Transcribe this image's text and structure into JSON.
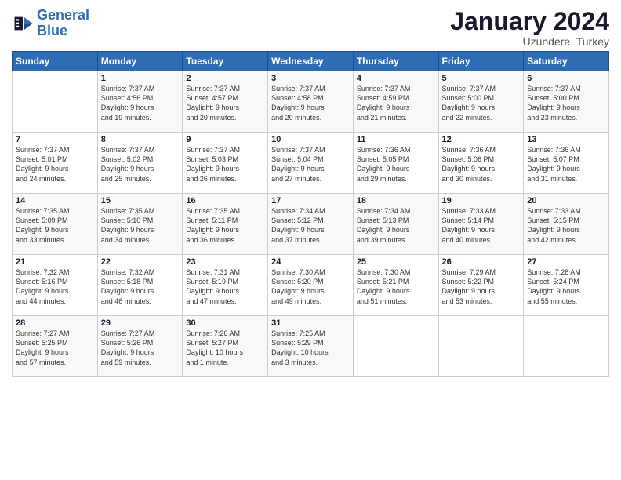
{
  "header": {
    "logo_general": "General",
    "logo_blue": "Blue",
    "month": "January 2024",
    "location": "Uzundere, Turkey"
  },
  "weekdays": [
    "Sunday",
    "Monday",
    "Tuesday",
    "Wednesday",
    "Thursday",
    "Friday",
    "Saturday"
  ],
  "weeks": [
    [
      {
        "day": "",
        "text": ""
      },
      {
        "day": "1",
        "text": "Sunrise: 7:37 AM\nSunset: 4:56 PM\nDaylight: 9 hours\nand 19 minutes."
      },
      {
        "day": "2",
        "text": "Sunrise: 7:37 AM\nSunset: 4:57 PM\nDaylight: 9 hours\nand 20 minutes."
      },
      {
        "day": "3",
        "text": "Sunrise: 7:37 AM\nSunset: 4:58 PM\nDaylight: 9 hours\nand 20 minutes."
      },
      {
        "day": "4",
        "text": "Sunrise: 7:37 AM\nSunset: 4:59 PM\nDaylight: 9 hours\nand 21 minutes."
      },
      {
        "day": "5",
        "text": "Sunrise: 7:37 AM\nSunset: 5:00 PM\nDaylight: 9 hours\nand 22 minutes."
      },
      {
        "day": "6",
        "text": "Sunrise: 7:37 AM\nSunset: 5:00 PM\nDaylight: 9 hours\nand 23 minutes."
      }
    ],
    [
      {
        "day": "7",
        "text": "Sunrise: 7:37 AM\nSunset: 5:01 PM\nDaylight: 9 hours\nand 24 minutes."
      },
      {
        "day": "8",
        "text": "Sunrise: 7:37 AM\nSunset: 5:02 PM\nDaylight: 9 hours\nand 25 minutes."
      },
      {
        "day": "9",
        "text": "Sunrise: 7:37 AM\nSunset: 5:03 PM\nDaylight: 9 hours\nand 26 minutes."
      },
      {
        "day": "10",
        "text": "Sunrise: 7:37 AM\nSunset: 5:04 PM\nDaylight: 9 hours\nand 27 minutes."
      },
      {
        "day": "11",
        "text": "Sunrise: 7:36 AM\nSunset: 5:05 PM\nDaylight: 9 hours\nand 29 minutes."
      },
      {
        "day": "12",
        "text": "Sunrise: 7:36 AM\nSunset: 5:06 PM\nDaylight: 9 hours\nand 30 minutes."
      },
      {
        "day": "13",
        "text": "Sunrise: 7:36 AM\nSunset: 5:07 PM\nDaylight: 9 hours\nand 31 minutes."
      }
    ],
    [
      {
        "day": "14",
        "text": "Sunrise: 7:35 AM\nSunset: 5:09 PM\nDaylight: 9 hours\nand 33 minutes."
      },
      {
        "day": "15",
        "text": "Sunrise: 7:35 AM\nSunset: 5:10 PM\nDaylight: 9 hours\nand 34 minutes."
      },
      {
        "day": "16",
        "text": "Sunrise: 7:35 AM\nSunset: 5:11 PM\nDaylight: 9 hours\nand 36 minutes."
      },
      {
        "day": "17",
        "text": "Sunrise: 7:34 AM\nSunset: 5:12 PM\nDaylight: 9 hours\nand 37 minutes."
      },
      {
        "day": "18",
        "text": "Sunrise: 7:34 AM\nSunset: 5:13 PM\nDaylight: 9 hours\nand 39 minutes."
      },
      {
        "day": "19",
        "text": "Sunrise: 7:33 AM\nSunset: 5:14 PM\nDaylight: 9 hours\nand 40 minutes."
      },
      {
        "day": "20",
        "text": "Sunrise: 7:33 AM\nSunset: 5:15 PM\nDaylight: 9 hours\nand 42 minutes."
      }
    ],
    [
      {
        "day": "21",
        "text": "Sunrise: 7:32 AM\nSunset: 5:16 PM\nDaylight: 9 hours\nand 44 minutes."
      },
      {
        "day": "22",
        "text": "Sunrise: 7:32 AM\nSunset: 5:18 PM\nDaylight: 9 hours\nand 46 minutes."
      },
      {
        "day": "23",
        "text": "Sunrise: 7:31 AM\nSunset: 5:19 PM\nDaylight: 9 hours\nand 47 minutes."
      },
      {
        "day": "24",
        "text": "Sunrise: 7:30 AM\nSunset: 5:20 PM\nDaylight: 9 hours\nand 49 minutes."
      },
      {
        "day": "25",
        "text": "Sunrise: 7:30 AM\nSunset: 5:21 PM\nDaylight: 9 hours\nand 51 minutes."
      },
      {
        "day": "26",
        "text": "Sunrise: 7:29 AM\nSunset: 5:22 PM\nDaylight: 9 hours\nand 53 minutes."
      },
      {
        "day": "27",
        "text": "Sunrise: 7:28 AM\nSunset: 5:24 PM\nDaylight: 9 hours\nand 55 minutes."
      }
    ],
    [
      {
        "day": "28",
        "text": "Sunrise: 7:27 AM\nSunset: 5:25 PM\nDaylight: 9 hours\nand 57 minutes."
      },
      {
        "day": "29",
        "text": "Sunrise: 7:27 AM\nSunset: 5:26 PM\nDaylight: 9 hours\nand 59 minutes."
      },
      {
        "day": "30",
        "text": "Sunrise: 7:26 AM\nSunset: 5:27 PM\nDaylight: 10 hours\nand 1 minute."
      },
      {
        "day": "31",
        "text": "Sunrise: 7:25 AM\nSunset: 5:29 PM\nDaylight: 10 hours\nand 3 minutes."
      },
      {
        "day": "",
        "text": ""
      },
      {
        "day": "",
        "text": ""
      },
      {
        "day": "",
        "text": ""
      }
    ]
  ]
}
